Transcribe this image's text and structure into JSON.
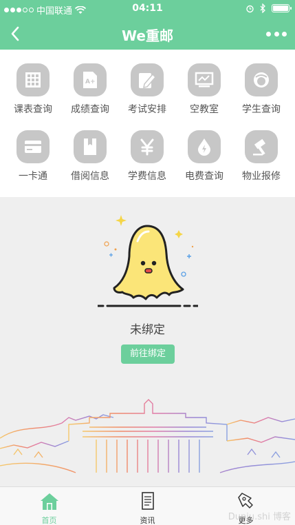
{
  "status_bar": {
    "carrier": "中国联通",
    "time": "04:11"
  },
  "nav": {
    "title": "We重邮"
  },
  "services": [
    {
      "label": "课表查询",
      "icon": "calendar-grid-icon"
    },
    {
      "label": "成绩查询",
      "icon": "grade-document-icon"
    },
    {
      "label": "考试安排",
      "icon": "pencil-icon"
    },
    {
      "label": "空教室",
      "icon": "blackboard-icon"
    },
    {
      "label": "学生查询",
      "icon": "student-avatar-icon"
    },
    {
      "label": "一卡通",
      "icon": "card-icon"
    },
    {
      "label": "借阅信息",
      "icon": "book-icon"
    },
    {
      "label": "学费信息",
      "icon": "yen-icon"
    },
    {
      "label": "电费查询",
      "icon": "electricity-drop-icon"
    },
    {
      "label": "物业报修",
      "icon": "hammer-icon"
    }
  ],
  "empty_state": {
    "message": "未绑定",
    "button_label": "前往绑定"
  },
  "tabs": [
    {
      "label": "首页",
      "icon": "home-icon",
      "active": true
    },
    {
      "label": "资讯",
      "icon": "news-icon",
      "active": false
    },
    {
      "label": "更多",
      "icon": "more-icon",
      "active": false
    }
  ],
  "watermark": "Duniu.shi 博客",
  "colors": {
    "accent": "#6ccf9c",
    "icon_bg": "#c7c7c7"
  }
}
